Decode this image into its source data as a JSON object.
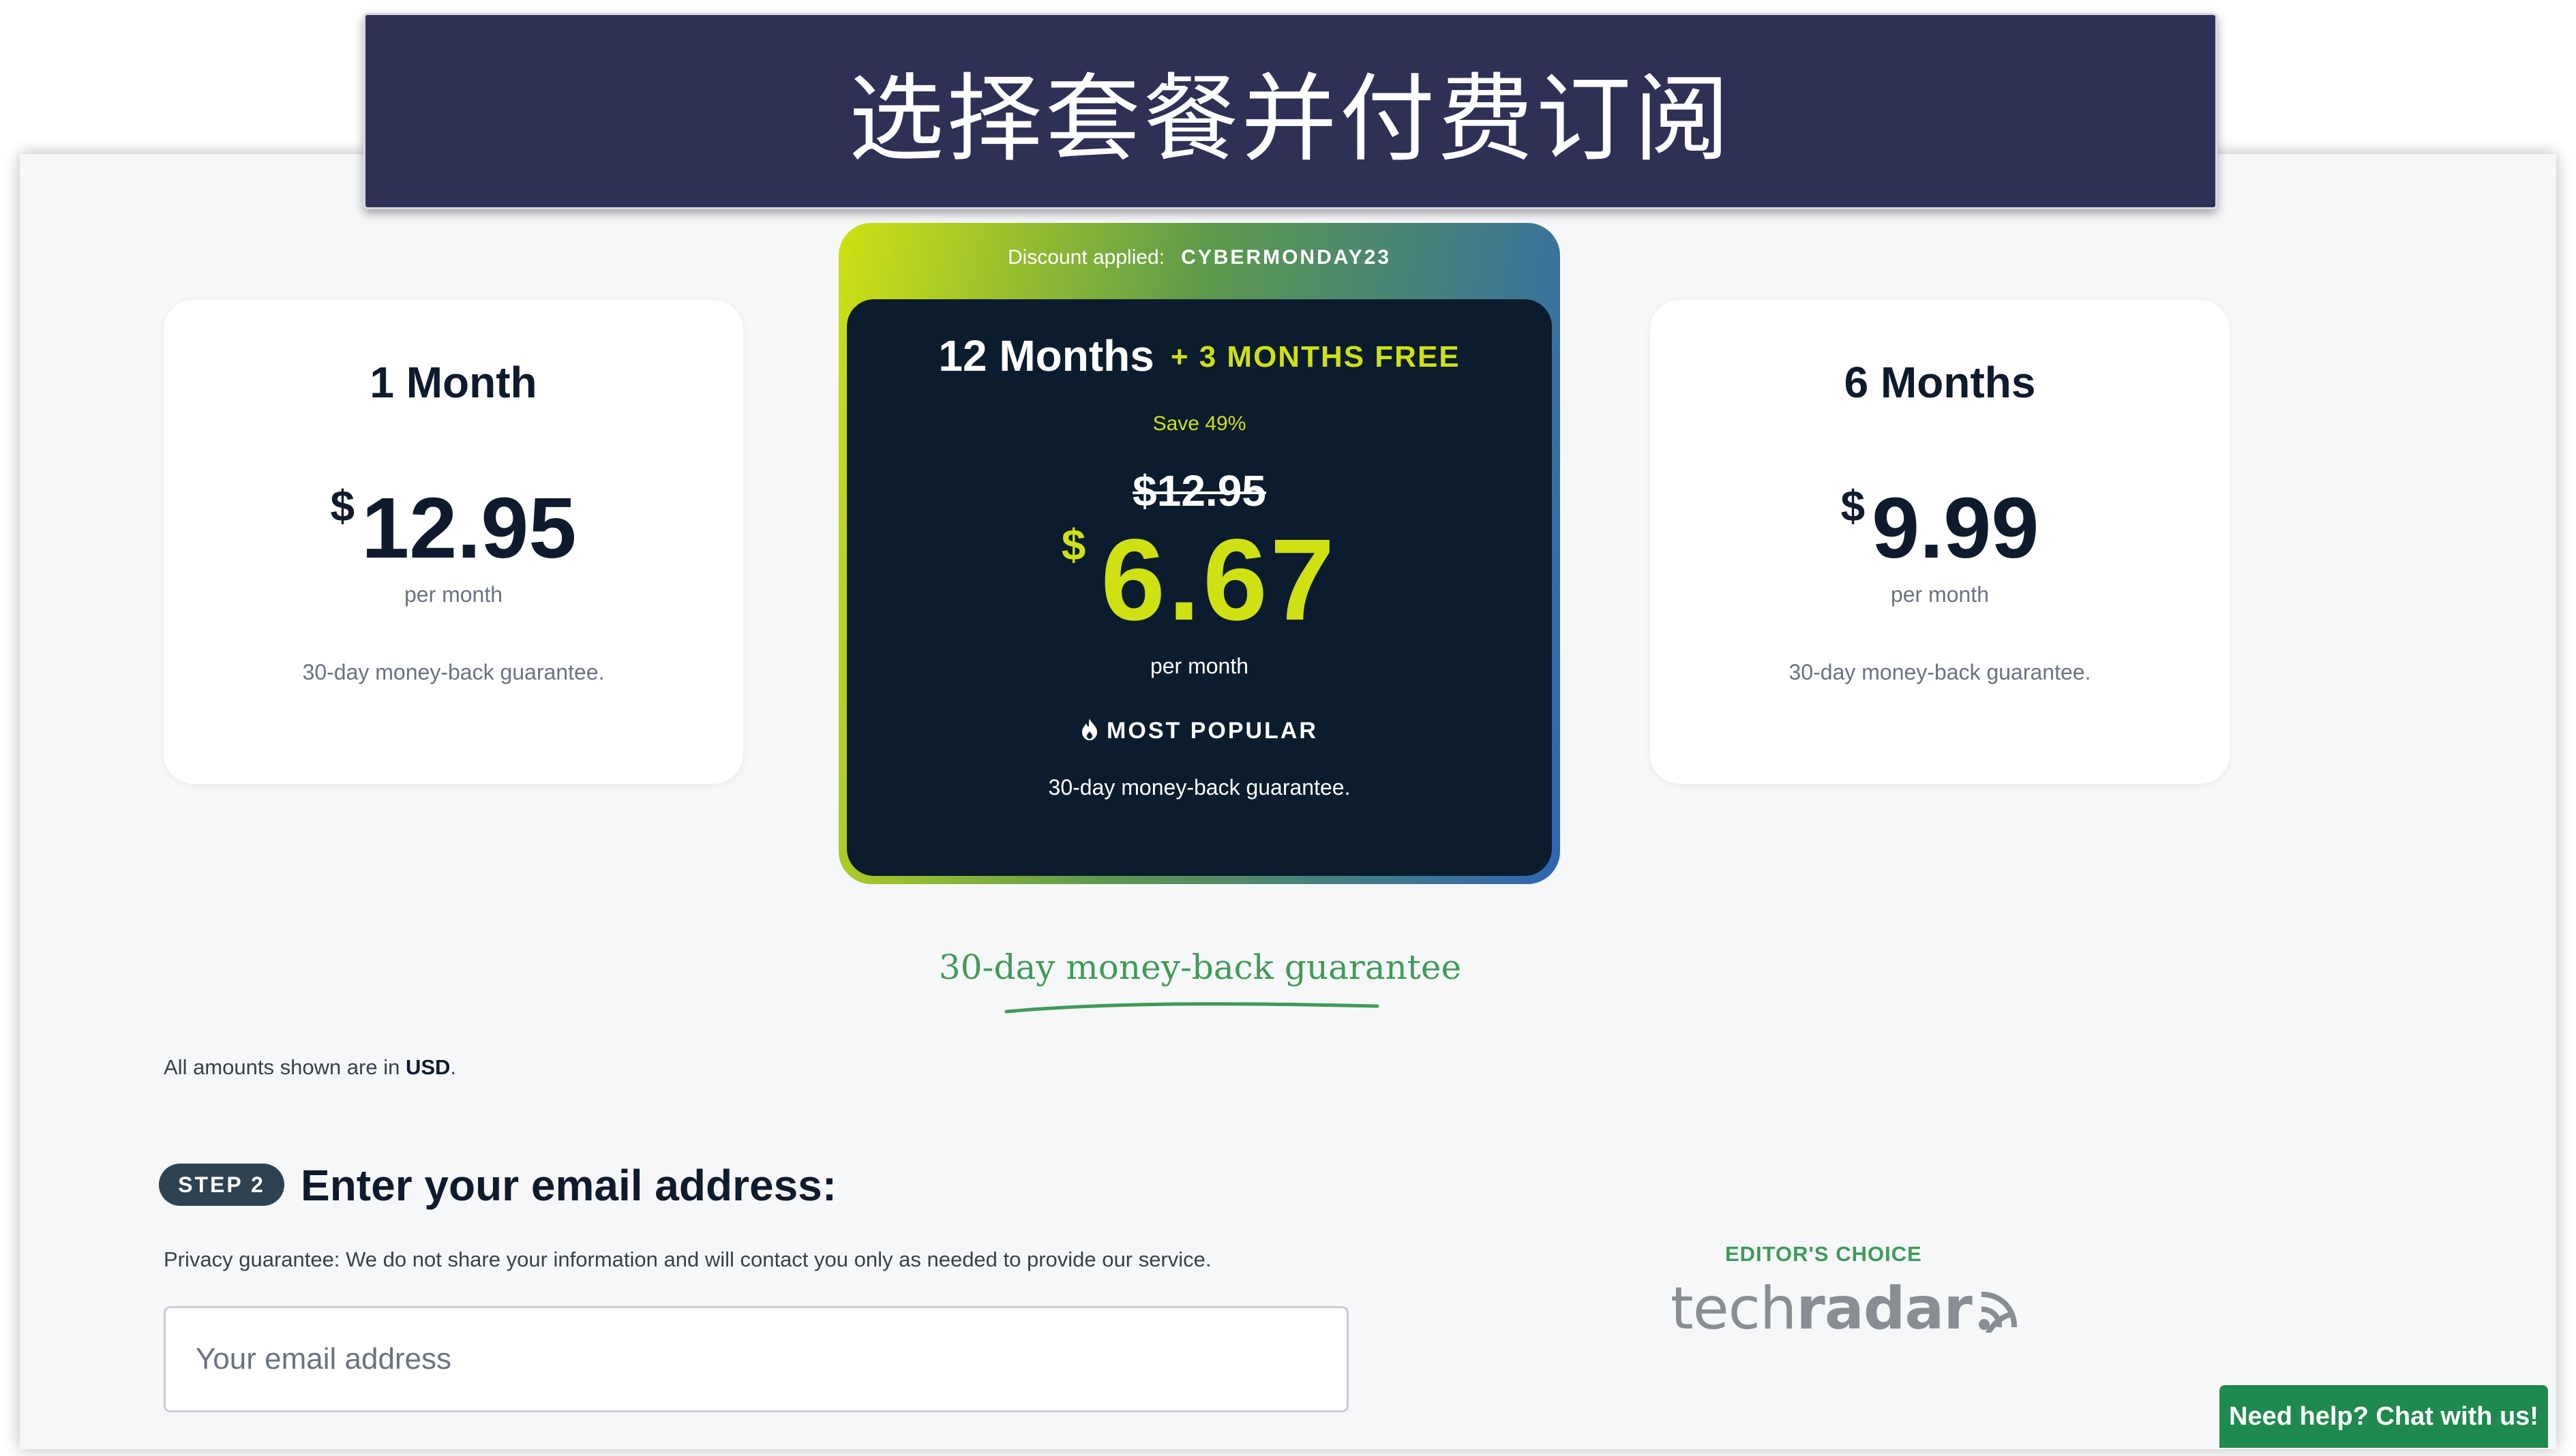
{
  "banner": {
    "title": "选择套餐并付费订阅"
  },
  "plans": {
    "one_month": {
      "title": "1 Month",
      "currency": "$",
      "price": "12.95",
      "period": "per month",
      "guarantee": "30-day money-back guarantee."
    },
    "twelve_months": {
      "discount_label": "Discount applied:",
      "discount_code": "CYBERMONDAY23",
      "title": "12 Months",
      "bonus": "+ 3 MONTHS FREE",
      "save": "Save 49%",
      "old_price": "$12.95",
      "currency": "$",
      "price": "6.67",
      "period": "per month",
      "badge": "MOST POPULAR",
      "guarantee": "30-day money-back guarantee."
    },
    "six_months": {
      "title": "6 Months",
      "currency": "$",
      "price": "9.99",
      "period": "per month",
      "guarantee": "30-day money-back guarantee."
    }
  },
  "money_back": "30-day money-back guarantee",
  "currency_note": {
    "prefix": "All amounts shown are in",
    "currency": "USD",
    "suffix": "."
  },
  "step2": {
    "badge": "STEP 2",
    "title": "Enter your email address:",
    "privacy": "Privacy guarantee: We do not share your information and will contact you only as needed to provide our service.",
    "email_placeholder": "Your email address",
    "email_value": ""
  },
  "award": {
    "label": "EDITOR'S CHOICE",
    "brand_light": "tech",
    "brand_bold": "radar"
  },
  "chat": {
    "label": "Need help? Chat with us!"
  },
  "colors": {
    "accent_green": "#cfe013",
    "dark_card": "#0b1c2e",
    "banner": "#2e3055",
    "chat": "#1f8a4f"
  }
}
